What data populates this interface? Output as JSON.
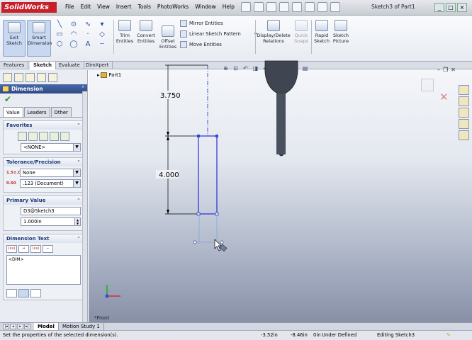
{
  "app": {
    "logo_text": "SolidWorks",
    "menu_items": [
      "File",
      "Edit",
      "View",
      "Insert",
      "Tools",
      "PhotoWorks",
      "Window",
      "Help"
    ],
    "document_title": "Sketch3 of Part1"
  },
  "command_manager": {
    "exit_sketch": "Exit Sketch",
    "smart_dimension": "Smart Dimension",
    "trim_entities": "Trim Entities",
    "convert_entities": "Convert Entities",
    "offset_entities": "Offset Entities",
    "mirror_entities": "Mirror Entities",
    "linear_sketch_pattern": "Linear Sketch Pattern",
    "move_entities": "Move Entities",
    "display_delete_relations": "Display/Delete Relations",
    "quick_snaps": "Quick Snaps",
    "rapid_sketch": "Rapid Sketch",
    "sketch_picture": "Sketch Picture"
  },
  "tabs": [
    "Features",
    "Sketch",
    "Evaluate",
    "DimXpert"
  ],
  "active_tab": "Sketch",
  "property_manager": {
    "title": "Dimension",
    "subtabs": [
      "Value",
      "Leaders",
      "Other"
    ],
    "favorites": {
      "header": "Favorites",
      "selected": "<NONE>"
    },
    "tolerance": {
      "header": "Tolerance/Precision",
      "tolerance_type": "None",
      "precision": ".123 (Document)"
    },
    "primary_value": {
      "header": "Primary Value",
      "name": "D3@Sketch3",
      "value": "1.000in"
    },
    "dimension_text": {
      "header": "Dimension Text",
      "content": "<DIM>"
    }
  },
  "graphics": {
    "tree_root": "Part1",
    "view_orientation": "*Front",
    "dimensions": [
      "3.750",
      "4.000"
    ]
  },
  "bottom_tabs": [
    "Model",
    "Motion Study 1"
  ],
  "status": {
    "message": "Set the properties of the selected dimension(s).",
    "x": "-3.52in",
    "y": "-8.46in",
    "z": "0in",
    "state": "Under Defined",
    "editing": "Editing Sketch3"
  }
}
